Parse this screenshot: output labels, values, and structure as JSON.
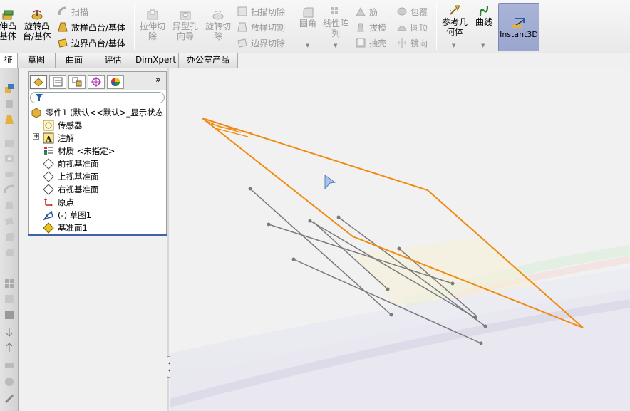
{
  "ribbon": {
    "extrude_boss": "伸凸\n基体",
    "revolve_boss": "旋转凸\n台/基体",
    "sweep": "扫描",
    "loft_boss": "放样凸台/基体",
    "boundary_boss": "边界凸台/基体",
    "extrude_cut": "拉伸切\n除",
    "hole_wizard": "异型孔\n向导",
    "revolve_cut": "旋转切\n除",
    "swept_cut": "扫描切除",
    "lofted_cut": "放样切割",
    "boundary_cut": "边界切除",
    "fillet": "圆角",
    "linear_pattern": "线性阵\n列",
    "rib": "筋",
    "draft": "拔模",
    "shell": "抽壳",
    "wrap": "包覆",
    "dome": "圆顶",
    "mirror": "镜向",
    "ref_geometry": "参考几\n何体",
    "curves": "曲线",
    "instant3d": "Instant3D"
  },
  "tabs": [
    {
      "label": "征",
      "active": true
    },
    {
      "label": "草图",
      "active": false
    },
    {
      "label": "曲面",
      "active": false
    },
    {
      "label": "评估",
      "active": false
    },
    {
      "label": "DimXpert",
      "active": false
    },
    {
      "label": "办公室产品",
      "active": false
    }
  ],
  "feature_tree": {
    "root": "零件1  (默认<<默认>_显示状态",
    "items": [
      {
        "label": "传感器",
        "icon": "sensor-icon"
      },
      {
        "label": "注解",
        "icon": "annotation-icon"
      },
      {
        "label": "材质 <未指定>",
        "icon": "material-icon"
      },
      {
        "label": "前视基准面",
        "icon": "plane-icon"
      },
      {
        "label": "上视基准面",
        "icon": "plane-icon"
      },
      {
        "label": "右视基准面",
        "icon": "plane-icon"
      },
      {
        "label": "原点",
        "icon": "origin-icon"
      },
      {
        "label": "(-) 草图1",
        "icon": "sketch-icon"
      },
      {
        "label": "基准面1",
        "icon": "plane-feature-icon"
      }
    ],
    "expand_marker": "+",
    "more_arrow": "»"
  },
  "colors": {
    "plane_outline": "#f08a10",
    "sketch_line": "#7a7a7a",
    "selection_blue": "#3f63a8",
    "instant3d_bg": "#9ba6cf"
  }
}
